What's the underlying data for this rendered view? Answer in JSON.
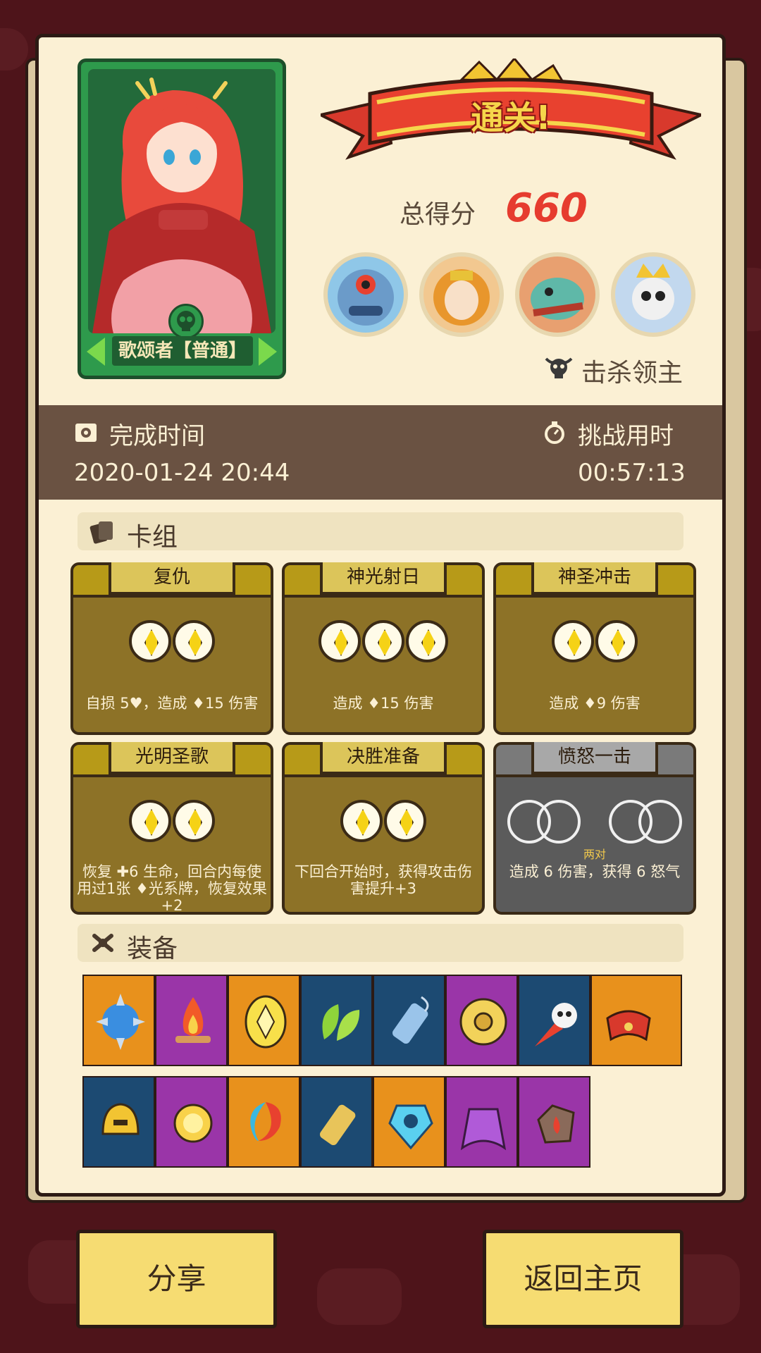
{
  "character": {
    "role_label": "歌颂者【普通】"
  },
  "result": {
    "title": "通关!",
    "score_label": "总得分",
    "score_value": "660",
    "kill_label": "击杀领主"
  },
  "bosses": [
    {
      "name": "boss-blue-cyclops"
    },
    {
      "name": "boss-orange-lion"
    },
    {
      "name": "boss-green-fish"
    },
    {
      "name": "boss-skeleton-knight"
    }
  ],
  "info": {
    "finish_time_label": "完成时间",
    "finish_time_value": "2020-01-24 20:44",
    "challenge_time_label": "挑战用时",
    "challenge_time_value": "00:57:13"
  },
  "deck": {
    "title": "卡组",
    "cards": [
      {
        "name": "复仇",
        "desc": "自损 5♥，造成 ♦15 伤害"
      },
      {
        "name": "神光射日",
        "desc": "造成 ♦15 伤害"
      },
      {
        "name": "神圣冲击",
        "desc": "造成 ♦9 伤害"
      },
      {
        "name": "光明圣歌",
        "desc": "恢复 ✚6 生命，回合内每使用过1张 ♦光系牌，恢复效果+2"
      },
      {
        "name": "决胜准备",
        "desc": "下回合开始时，获得攻击伤害提升+3"
      },
      {
        "name": "愤怒一击",
        "desc": "造成 6 伤害，获得 6 怒气",
        "cost_note": "两对"
      }
    ]
  },
  "equipment": {
    "title": "装备"
  },
  "buttons": {
    "share": "分享",
    "home": "返回主页"
  },
  "colors": {
    "slot_orange": "#e8911c",
    "slot_purple": "#9a35a8",
    "slot_blue": "#1c4a72",
    "accent_red": "#e63c2f"
  }
}
